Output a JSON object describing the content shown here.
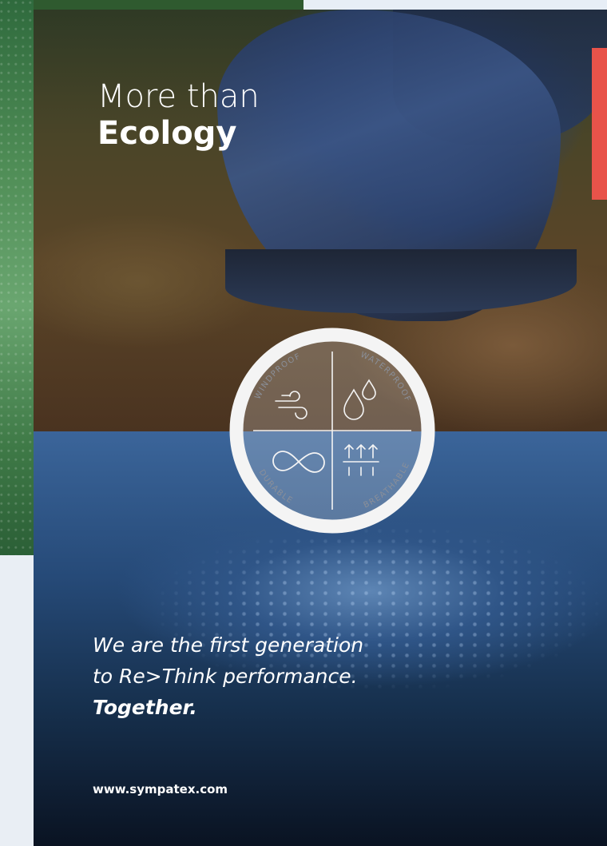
{
  "headline": {
    "line1": "More than",
    "line2": "Ecology"
  },
  "badge": {
    "labels": {
      "top_left": "WINDPROOF",
      "top_right": "WATERPROOF",
      "bottom_left": "DURABLE",
      "bottom_right": "BREATHABLE"
    },
    "icons": [
      "wind-icon",
      "water-drops-icon",
      "infinity-icon",
      "breathable-arrows-icon"
    ]
  },
  "tagline": {
    "line1": "We are the first generation",
    "line2": "to Re>Think performance.",
    "line3": "Together."
  },
  "website": "www.sympatex.com",
  "colors": {
    "accent_red": "#e8534a",
    "badge_white": "#f4f4f4"
  }
}
